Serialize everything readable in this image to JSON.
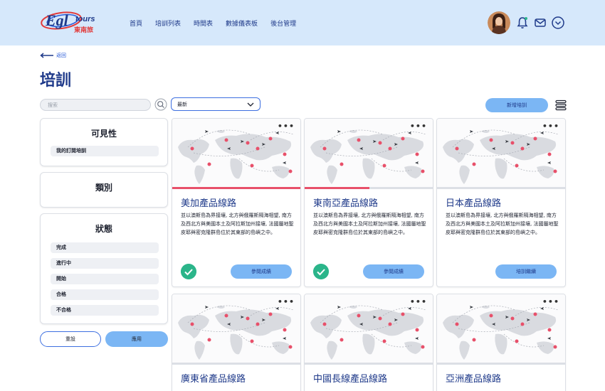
{
  "header": {
    "logo_text": "Egltours",
    "logo_subtext": "東南旅",
    "nav": [
      "首頁",
      "培訓列表",
      "時間表",
      "數據儀表板",
      "後台管理"
    ]
  },
  "back_label": "返回",
  "page_title": "培訓",
  "toolbar": {
    "search_placeholder": "搜索",
    "sort_value": "最新",
    "add_label": "新增培訓"
  },
  "filters": {
    "visibility": {
      "title": "可見性",
      "items": [
        "我的訂閱培訓"
      ]
    },
    "category": {
      "title": "類別"
    },
    "status": {
      "title": "狀態",
      "items": [
        "完成",
        "進行中",
        "開始",
        "合格",
        "不合格"
      ]
    },
    "reset_label": "重設",
    "apply_label": "應用"
  },
  "cards": [
    {
      "title": "美加產品線路",
      "desc": "並以澳斯島為界接壤, 北方與俄羅斯隔海相望, 南方及西北方與美國本土及阿拉斯加州接壤, 法國屬地聖皮耶與密克隆群島位於其東部的島嶼之中。",
      "button": "參閱成績",
      "progress": 1.0,
      "completed": true
    },
    {
      "title": "東南亞產品線路",
      "desc": "並以澳斯島為界接壤, 北方與俄羅斯隔海相望, 南方及西北方與美國本土及阿拉斯加州接壤, 法國屬地聖皮耶與密克隆群島位於其東部的島嶼之中。",
      "button": "參閱成績",
      "progress": 0.5,
      "completed": true
    },
    {
      "title": "日本產品線路",
      "desc": "並以澳斯島為界接壤, 北方與俄羅斯隔海相望, 南方及西北方與美國本土及阿拉斯加州接壤, 法國屬地聖皮耶與密克隆群島位於其東部的島嶼之中。",
      "button": "培訓繼續",
      "progress": 0,
      "completed": false
    },
    {
      "title": "廣東省產品線路"
    },
    {
      "title": "中國長線產品線路"
    },
    {
      "title": "亞洲產品線路"
    }
  ],
  "colors": {
    "header_bg": "#d6e8fb",
    "primary": "#1f3a8a",
    "button_bg": "#7bb6f4",
    "progress": "#e8506a",
    "success": "#2bb58a"
  }
}
